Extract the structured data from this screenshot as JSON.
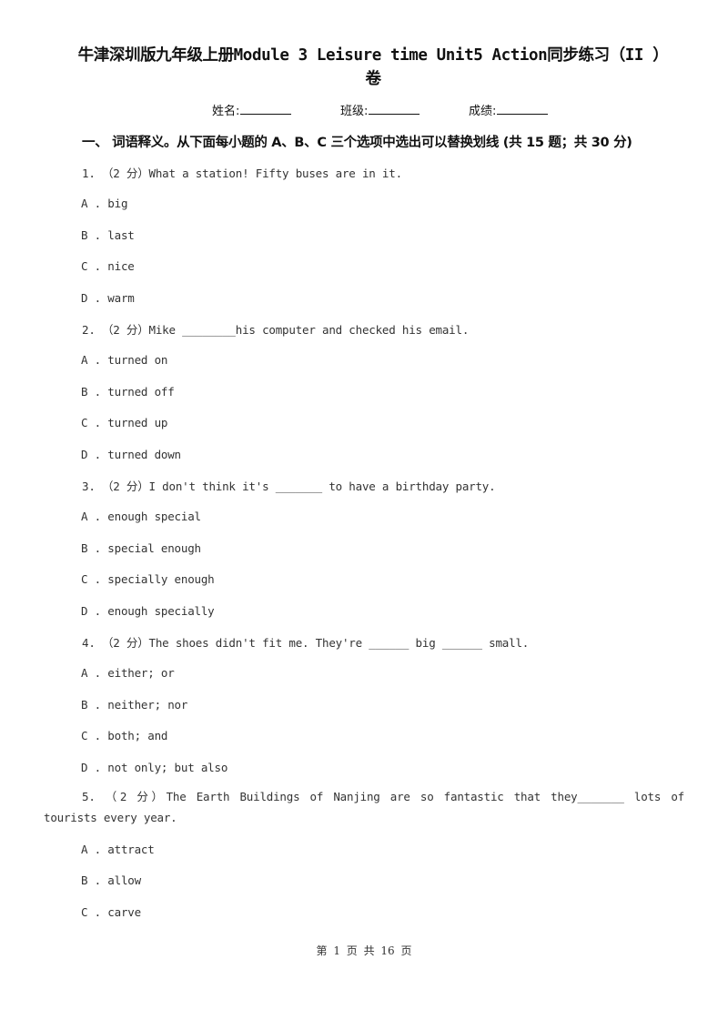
{
  "document": {
    "title_line1": "牛津深圳版九年级上册Module 3 Leisure time Unit5 Action同步练习（II ）",
    "title_line2": "卷",
    "info": {
      "name_label": "姓名:",
      "class_label": "班级:",
      "score_label": "成绩:"
    },
    "section": {
      "heading": "一、 词语释义。从下面每小题的 A、B、C 三个选项中选出可以替换划线 (共 15 题；共 30 分)"
    },
    "questions": [
      {
        "stem": "1.  （2 分）What a          station! Fifty buses are in it.",
        "options": [
          "A . big",
          "B . last",
          "C . nice",
          "D . warm"
        ]
      },
      {
        "stem": "2.  （2 分）Mike ________his computer and checked his email.",
        "options": [
          "A . turned on",
          "B . turned off",
          "C . turned up",
          "D . turned down"
        ]
      },
      {
        "stem": "3.  （2 分）I don't think it's _______ to have a birthday party.",
        "options": [
          "A . enough special",
          "B . special enough",
          "C . specially enough",
          "D . enough specially"
        ]
      },
      {
        "stem": "4.  （2 分）The shoes didn't fit me. They're ______ big ______ small.",
        "options": [
          "A . either; or",
          "B . neither; nor",
          "C . both; and",
          "D . not only; but also"
        ]
      },
      {
        "stem": "5.  （2 分）The Earth Buildings of Nanjing are so fantastic that they_______ lots of tourists every year.",
        "options": [
          "A . attract",
          "B . allow",
          "C . carve"
        ]
      }
    ],
    "footer": "第 1 页 共 16 页"
  }
}
